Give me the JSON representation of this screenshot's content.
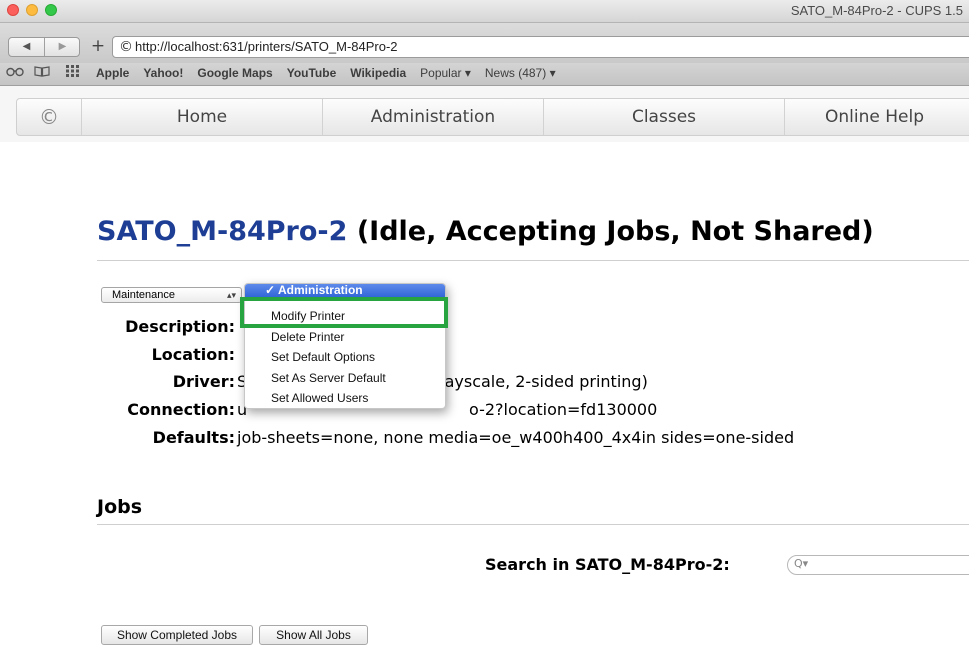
{
  "window": {
    "title": "SATO_M-84Pro-2 - CUPS 1.5"
  },
  "toolbar": {
    "back_icon": "◀",
    "forward_icon": "▶",
    "new_tab_icon": "+",
    "url": "http://localhost:631/printers/SATO_M-84Pro-2"
  },
  "bookmarks": {
    "reader_icon": "reading-glasses-icon",
    "book_icon": "bookmarks-book-icon",
    "grid_icon": "top-sites-grid-icon",
    "items": [
      "Apple",
      "Yahoo!",
      "Google Maps",
      "YouTube",
      "Wikipedia",
      "Popular ▾",
      "News (487) ▾"
    ]
  },
  "nav": {
    "home": "Home",
    "administration": "Administration",
    "classes": "Classes",
    "online_help": "Online Help"
  },
  "printer": {
    "name": "SATO_M-84Pro-2",
    "status": "(Idle, Accepting Jobs, Not Shared)",
    "maintenance_select": "Maintenance",
    "labels": {
      "description": "Description:",
      "location": "Location:",
      "driver": "Driver:",
      "connection": "Connection:",
      "defaults": "Defaults:"
    },
    "driver_visible": "S",
    "driver_tail": "rayscale, 2-sided printing)",
    "connection_visible": "u",
    "connection_tail": "o-2?location=fd130000",
    "defaults": "job-sheets=none, none media=oe_w400h400_4x4in sides=one-sided"
  },
  "admin_menu": {
    "header": "✓ Administration",
    "items": [
      "Modify Printer",
      "Delete Printer",
      "Set Default Options",
      "Set As Server Default",
      "Set Allowed Users"
    ]
  },
  "jobs": {
    "heading": "Jobs",
    "search_label": "Search in SATO_M-84Pro-2:",
    "search_placeholder": "Q▾",
    "show_completed": "Show Completed Jobs",
    "show_all": "Show All Jobs"
  },
  "colors": {
    "printer_name": "#1d3e94",
    "highlight_box": "#27a340",
    "menu_header": "#2c62d6"
  }
}
